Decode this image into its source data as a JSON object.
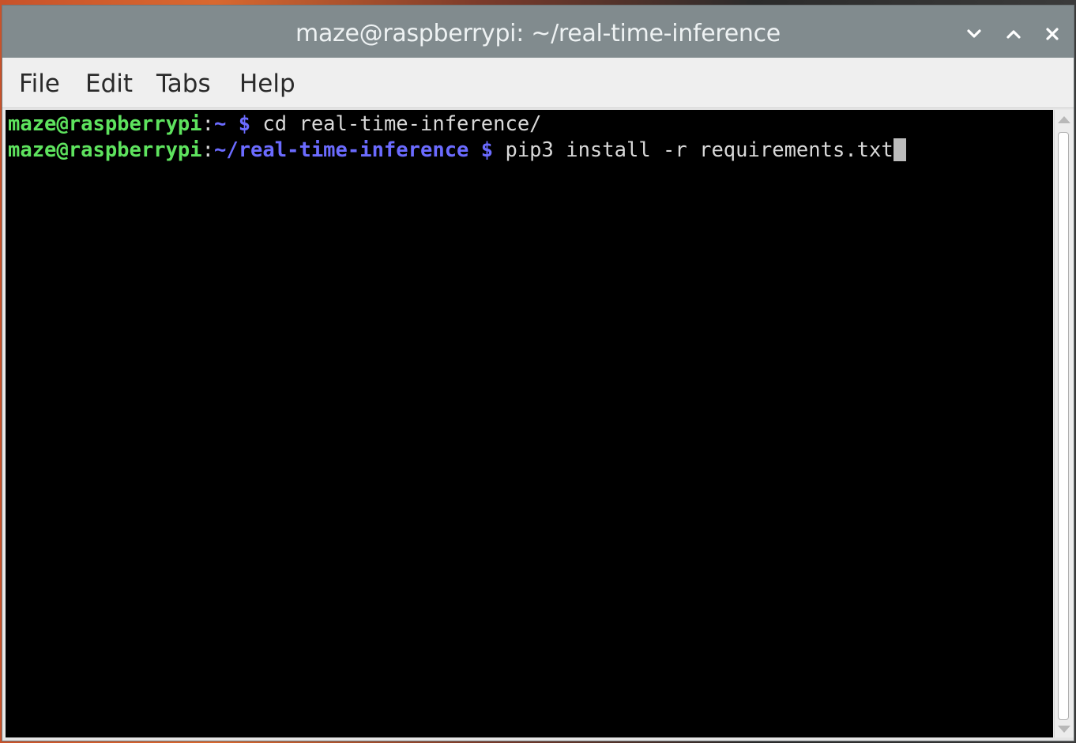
{
  "window": {
    "title": "maze@raspberrypi: ~/real-time-inference",
    "controls": {
      "minimize_icon": "chevron-down-icon",
      "maximize_icon": "chevron-up-icon",
      "close_icon": "close-icon"
    }
  },
  "menubar": {
    "items": [
      {
        "label": "File"
      },
      {
        "label": "Edit"
      },
      {
        "label": "Tabs"
      },
      {
        "label": "Help"
      }
    ]
  },
  "terminal": {
    "lines": [
      {
        "user_host": "maze@raspberrypi",
        "separator": ":",
        "path": "~",
        "prompt": " $ ",
        "command": "cd real-time-inference/"
      },
      {
        "user_host": "maze@raspberrypi",
        "separator": ":",
        "path": "~/real-time-inference",
        "prompt": " $ ",
        "command": "pip3 install -r requirements.txt"
      }
    ]
  },
  "colors": {
    "titlebar_bg": "#818b8e",
    "terminal_bg": "#000000",
    "prompt_user": "#5ee35e",
    "prompt_path": "#6b6bff",
    "terminal_text": "#d8d8d8"
  }
}
